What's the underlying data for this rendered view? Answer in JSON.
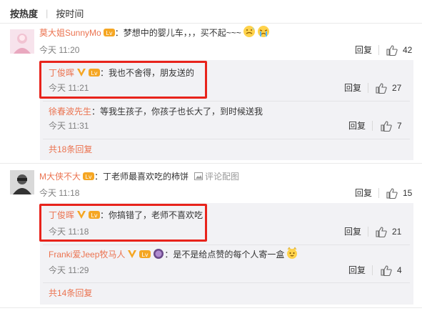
{
  "sort": {
    "hot": "按热度",
    "time": "按时间"
  },
  "colors": {
    "name": "#eb7350",
    "highlight": "#e8231b",
    "vip": "#f5a623",
    "subbg": "#f2f2f5"
  },
  "comments": [
    {
      "user": "莫大姐SunnyMo",
      "text": "：梦想中的婴儿车，，，买不起~~~",
      "time": "今天 11:20",
      "reply": "回复",
      "likes": "42",
      "replies": [
        {
          "user": "丁俊晖",
          "text": "：我也不舍得，朋友送的",
          "time": "今天 11:21",
          "reply": "回复",
          "likes": "27"
        },
        {
          "user": "徐春波先生",
          "text": "：等我生孩子，你孩子也长大了，到时候送我",
          "time": "今天 11:31",
          "reply": "回复",
          "likes": "7"
        }
      ],
      "more": "共18条回复"
    },
    {
      "user": "M大侠不大",
      "text": "：丁老师最喜欢吃的柿饼",
      "report": "评论配图",
      "time": "今天 11:18",
      "reply": "回复",
      "likes": "15",
      "replies": [
        {
          "user": "丁俊晖",
          "text": "：你搞错了，老师不喜欢吃",
          "time": "今天 11:18",
          "reply": "回复",
          "likes": "21"
        },
        {
          "user": "Franki爱Jeep牧马人",
          "text": "：是不是给点赞的每个人寄一盒",
          "time": "今天 11:29",
          "reply": "回复",
          "likes": "4"
        }
      ],
      "more": "共14条回复"
    }
  ]
}
